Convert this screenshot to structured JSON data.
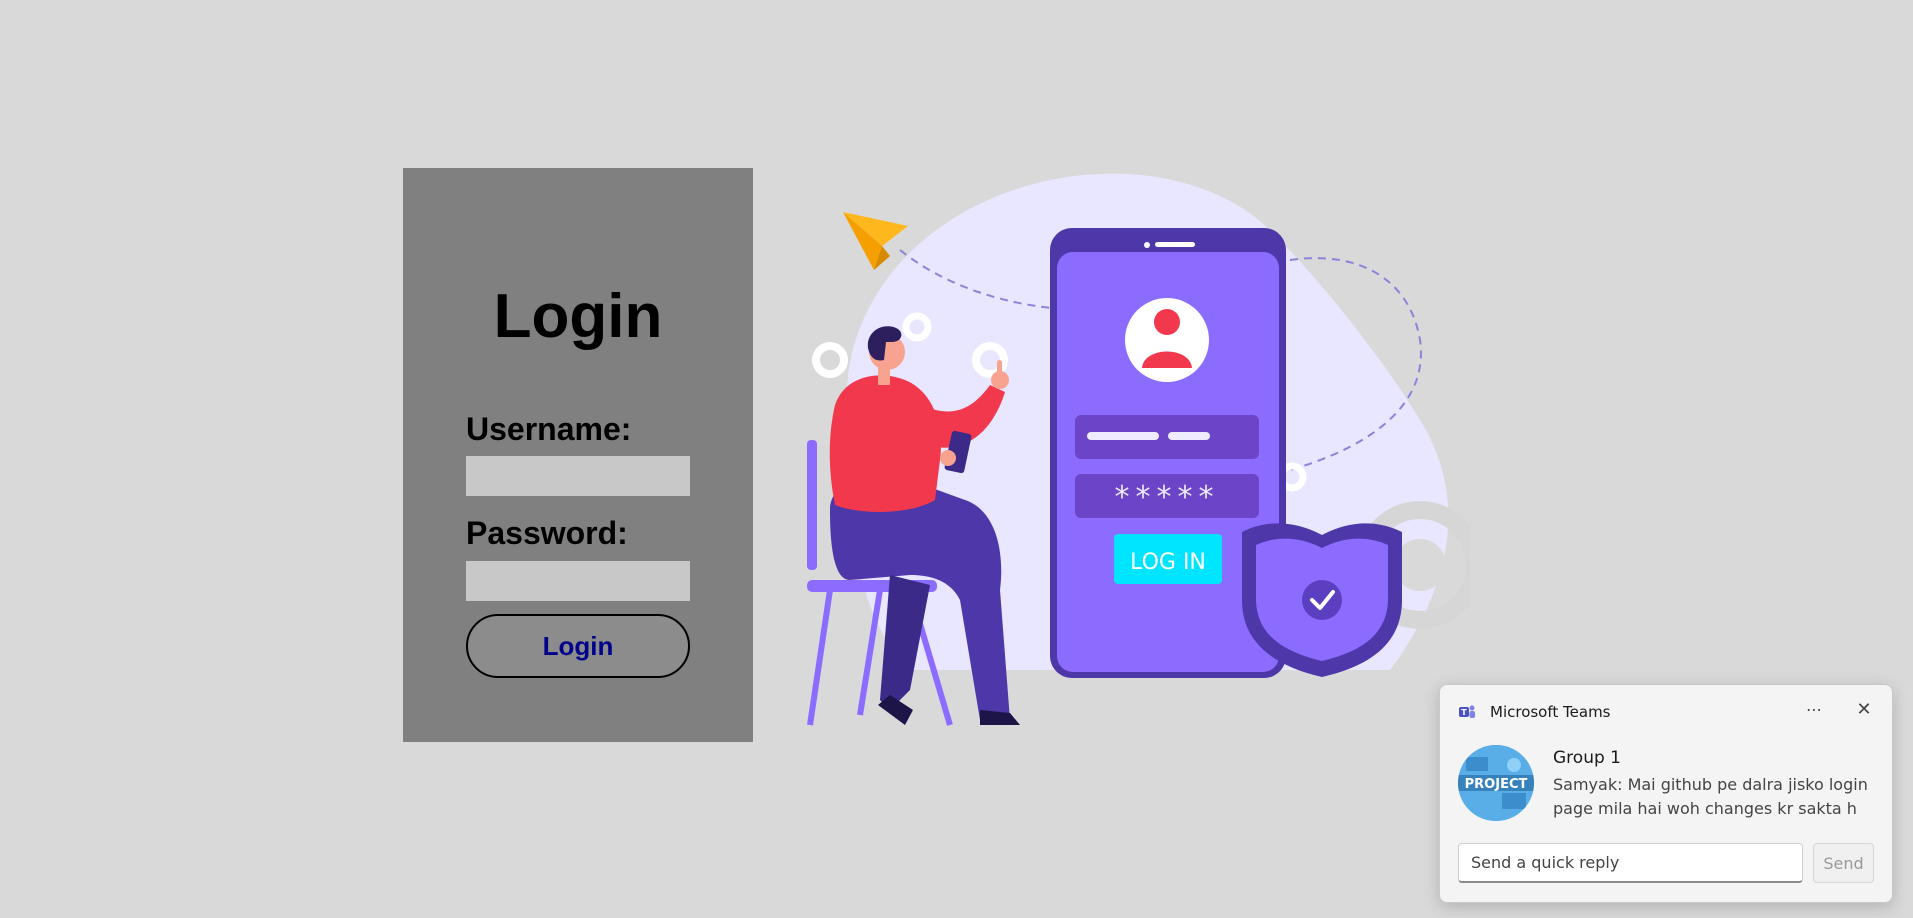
{
  "login": {
    "title": "Login",
    "username_label": "Username:",
    "username_value": "",
    "password_label": "Password:",
    "password_value": "",
    "button_label": "Login"
  },
  "illustration": {
    "password_mask": "*****",
    "phone_button_label": "LOG IN"
  },
  "toast": {
    "app_name": "Microsoft Teams",
    "more_icon": "more-options-icon",
    "close_icon": "close-icon",
    "avatar_text": "PROJECT",
    "group_name": "Group 1",
    "message": "Samyak: Mai github pe dalra jisko login page mila hai woh changes kr sakta h",
    "reply_placeholder": "Send a quick reply",
    "send_label": "Send"
  },
  "colors": {
    "page_background": "#d9d9d9",
    "panel_background": "#808080",
    "button_text": "#00008b",
    "phone_purple": "#8c6cff",
    "accent_red": "#f2384d",
    "accent_cyan": "#00e5ff"
  }
}
